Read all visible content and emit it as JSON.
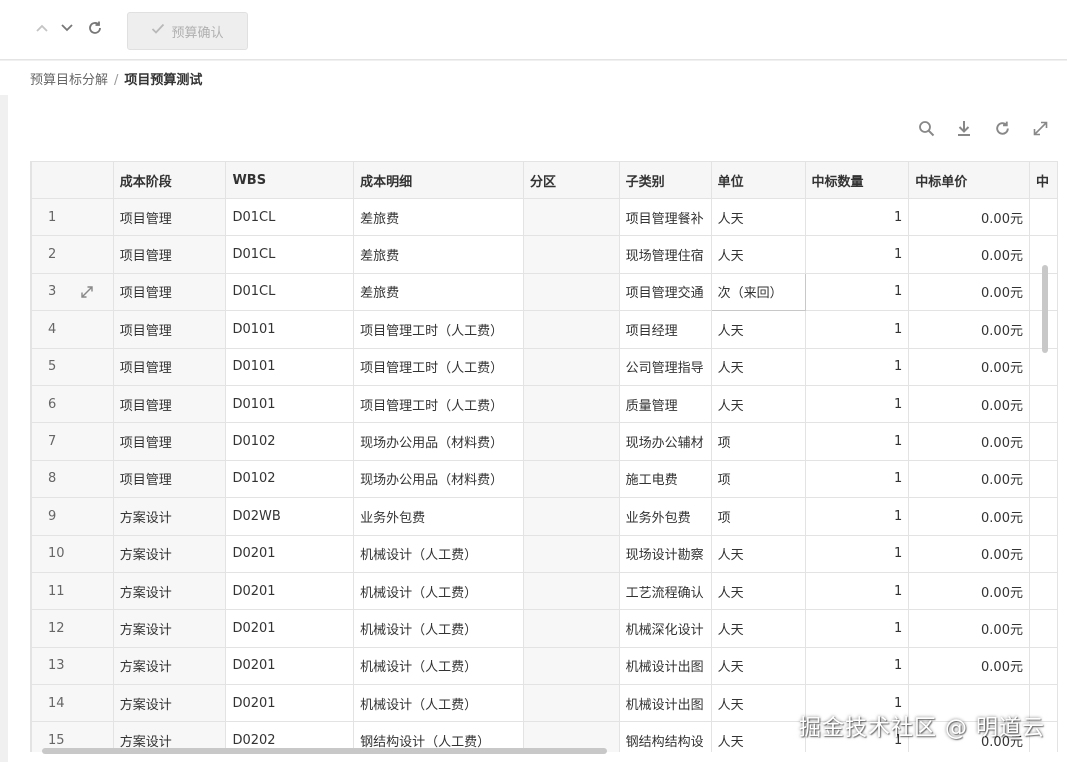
{
  "toolbar": {
    "confirm_label": "预算确认",
    "up_icon": "chevron-up-icon",
    "down_icon": "chevron-down-icon",
    "refresh_icon": "refresh-icon"
  },
  "breadcrumb": {
    "parent": "预算目标分解",
    "separator": "/",
    "current": "项目预算测试"
  },
  "grid_tools": [
    "search-icon",
    "download-icon",
    "refresh-icon",
    "fullscreen-icon"
  ],
  "table": {
    "columns": [
      "",
      "成本阶段",
      "WBS",
      "成本明细",
      "分区",
      "子类别",
      "单位",
      "中标数量",
      "中标单价",
      "中"
    ],
    "rows": [
      {
        "idx": "1",
        "stage": "项目管理",
        "wbs": "D01CL",
        "detail": "差旅费",
        "zone": "",
        "sub": "项目管理餐补",
        "unit": "人天",
        "qty": "1",
        "price": "0.00元"
      },
      {
        "idx": "2",
        "stage": "项目管理",
        "wbs": "D01CL",
        "detail": "差旅费",
        "zone": "",
        "sub": "现场管理住宿",
        "unit": "人天",
        "qty": "1",
        "price": "0.00元"
      },
      {
        "idx": "3",
        "stage": "项目管理",
        "wbs": "D01CL",
        "detail": "差旅费",
        "zone": "",
        "sub": "项目管理交通",
        "unit": "次（来回）",
        "qty": "1",
        "price": "0.00元"
      },
      {
        "idx": "4",
        "stage": "项目管理",
        "wbs": "D0101",
        "detail": "项目管理工时（人工费）",
        "zone": "",
        "sub": "项目经理",
        "unit": "人天",
        "qty": "1",
        "price": "0.00元"
      },
      {
        "idx": "5",
        "stage": "项目管理",
        "wbs": "D0101",
        "detail": "项目管理工时（人工费）",
        "zone": "",
        "sub": "公司管理指导",
        "unit": "人天",
        "qty": "1",
        "price": "0.00元"
      },
      {
        "idx": "6",
        "stage": "项目管理",
        "wbs": "D0101",
        "detail": "项目管理工时（人工费）",
        "zone": "",
        "sub": "质量管理",
        "unit": "人天",
        "qty": "1",
        "price": "0.00元"
      },
      {
        "idx": "7",
        "stage": "项目管理",
        "wbs": "D0102",
        "detail": "现场办公用品（材料费）",
        "zone": "",
        "sub": "现场办公辅材",
        "unit": "项",
        "qty": "1",
        "price": "0.00元"
      },
      {
        "idx": "8",
        "stage": "项目管理",
        "wbs": "D0102",
        "detail": "现场办公用品（材料费）",
        "zone": "",
        "sub": "施工电费",
        "unit": "项",
        "qty": "1",
        "price": "0.00元"
      },
      {
        "idx": "9",
        "stage": "方案设计",
        "wbs": "D02WB",
        "detail": "业务外包费",
        "zone": "",
        "sub": "业务外包费",
        "unit": "项",
        "qty": "1",
        "price": "0.00元"
      },
      {
        "idx": "10",
        "stage": "方案设计",
        "wbs": "D0201",
        "detail": "机械设计（人工费）",
        "zone": "",
        "sub": "现场设计勘察",
        "unit": "人天",
        "qty": "1",
        "price": "0.00元"
      },
      {
        "idx": "11",
        "stage": "方案设计",
        "wbs": "D0201",
        "detail": "机械设计（人工费）",
        "zone": "",
        "sub": "工艺流程确认",
        "unit": "人天",
        "qty": "1",
        "price": "0.00元"
      },
      {
        "idx": "12",
        "stage": "方案设计",
        "wbs": "D0201",
        "detail": "机械设计（人工费）",
        "zone": "",
        "sub": "机械深化设计",
        "unit": "人天",
        "qty": "1",
        "price": "0.00元"
      },
      {
        "idx": "13",
        "stage": "方案设计",
        "wbs": "D0201",
        "detail": "机械设计（人工费）",
        "zone": "",
        "sub": "机械设计出图",
        "unit": "人天",
        "qty": "1",
        "price": "0.00元"
      },
      {
        "idx": "14",
        "stage": "方案设计",
        "wbs": "D0201",
        "detail": "机械设计（人工费）",
        "zone": "",
        "sub": "机械设计出图",
        "unit": "人天",
        "qty": "1",
        "price": ""
      },
      {
        "idx": "15",
        "stage": "方案设计",
        "wbs": "D0202",
        "detail": "钢结构设计（人工费）",
        "zone": "",
        "sub": "钢结构结构设",
        "unit": "人天",
        "qty": "1",
        "price": "0.00元"
      }
    ]
  },
  "watermark": "掘金技术社区 @ 明道云"
}
